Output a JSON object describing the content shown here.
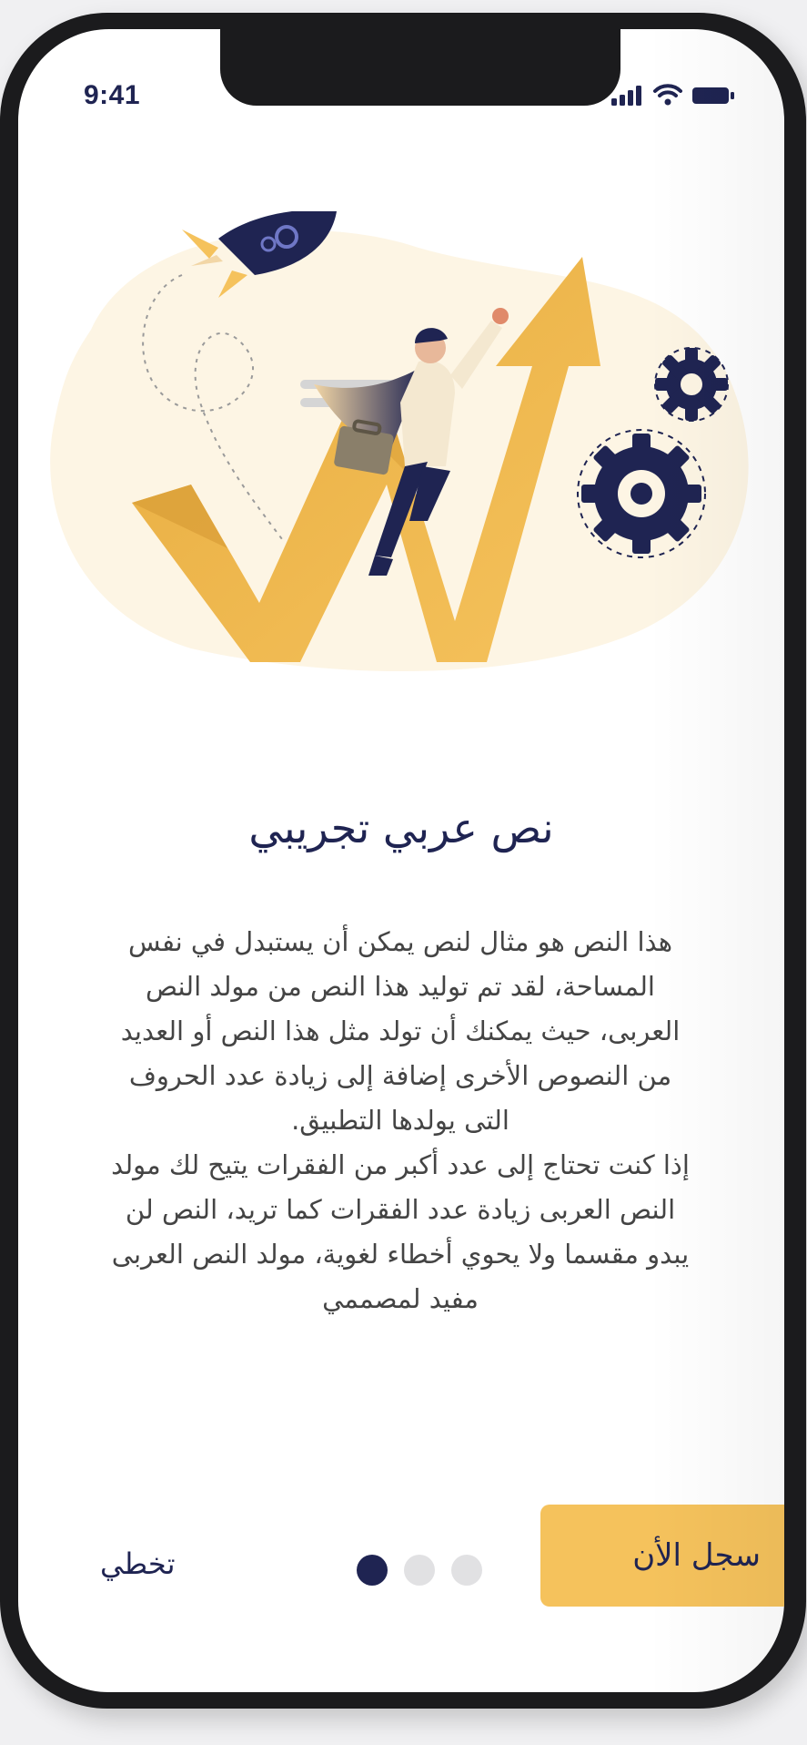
{
  "status_bar": {
    "time": "9:41",
    "icons": [
      "cellular-signal-icon",
      "wifi-icon",
      "battery-icon"
    ]
  },
  "onboarding": {
    "title": "نص عربي تجريبي",
    "paragraph_1": "هذا النص هو مثال لنص يمكن أن يستبدل في نفس المساحة، لقد تم توليد هذا النص من مولد النص العربى، حيث يمكنك أن تولد مثل هذا النص أو العديد من النصوص الأخرى إضافة إلى زيادة عدد الحروف التى يولدها التطبيق.",
    "paragraph_2": "إذا كنت تحتاج إلى عدد أكبر من الفقرات يتيح لك مولد النص العربى زيادة عدد الفقرات كما تريد، النص لن يبدو مقسما ولا يحوي أخطاء لغوية، مولد النص العربى مفيد لمصممي",
    "page_indicator": {
      "total": 3,
      "active": 1
    },
    "skip_label": "تخطي",
    "cta_label": "سجل الأن"
  },
  "colors": {
    "primary_navy": "#1f2452",
    "accent_yellow": "#f5c25c",
    "illustration_bg": "#fdf5e4",
    "dot_inactive": "#e1e1e3"
  }
}
